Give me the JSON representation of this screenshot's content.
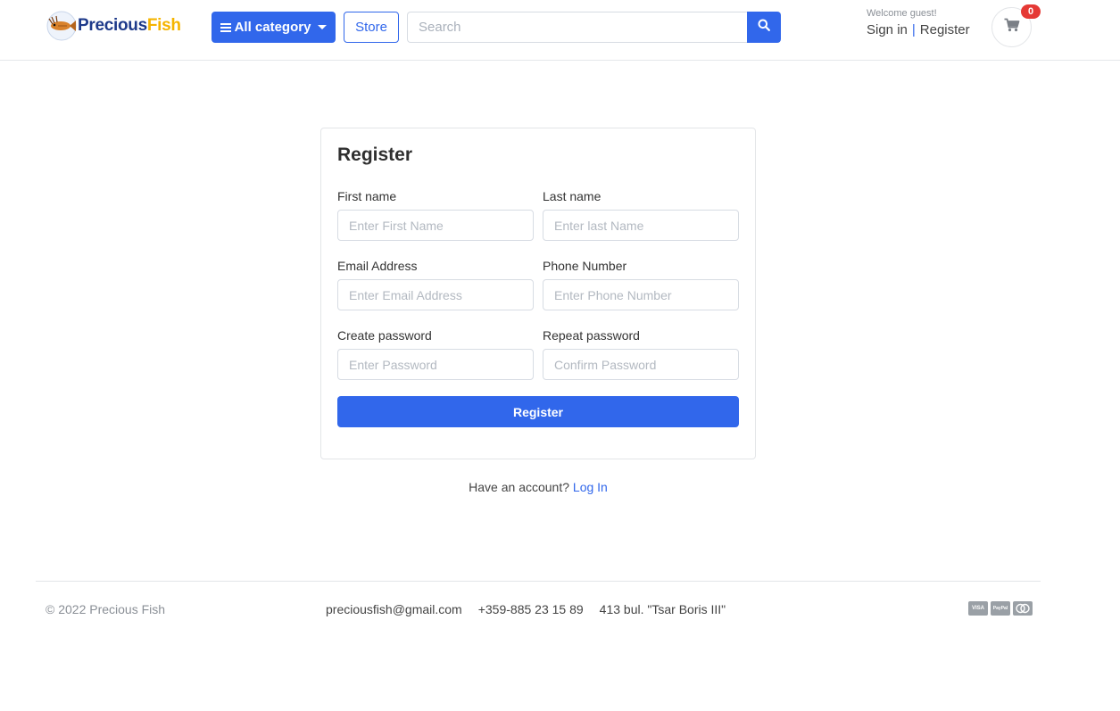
{
  "header": {
    "logo": {
      "text_part1": "Precious",
      "text_part2": "Fish"
    },
    "category_button": "All category",
    "store_button": "Store",
    "search": {
      "placeholder": "Search",
      "value": ""
    },
    "welcome": "Welcome guest!",
    "sign_in": "Sign in",
    "separator": "|",
    "register": "Register",
    "cart_count": "0"
  },
  "form": {
    "title": "Register",
    "fields": [
      {
        "label": "First name",
        "placeholder": "Enter First Name"
      },
      {
        "label": "Last name",
        "placeholder": "Enter last Name"
      },
      {
        "label": "Email Address",
        "placeholder": "Enter Email Address"
      },
      {
        "label": "Phone Number",
        "placeholder": "Enter Phone Number"
      },
      {
        "label": "Create password",
        "placeholder": "Enter Password"
      },
      {
        "label": "Repeat password",
        "placeholder": "Confirm Password"
      }
    ],
    "submit_label": "Register",
    "have_account": "Have an account?",
    "login_link": "Log In"
  },
  "footer": {
    "copyright": "© 2022 Precious Fish",
    "email": "preciousfish@gmail.com",
    "phone": "+359-885 23 15 89",
    "address": "413 bul. \"Tsar Boris III\"",
    "payments": [
      "VISA",
      "PayPal",
      "mastercard"
    ]
  },
  "colors": {
    "primary": "#3167eb",
    "badge": "#e53935",
    "logo_dark": "#1e3a8a",
    "logo_accent": "#f5b400"
  },
  "icons": {
    "category": "bars-icon",
    "search": "search-icon",
    "cart": "shopping-cart-icon"
  }
}
